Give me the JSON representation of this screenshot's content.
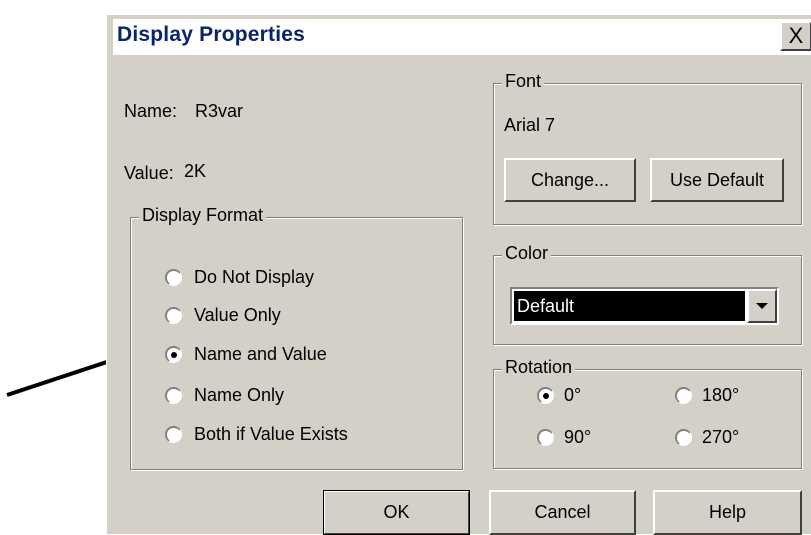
{
  "dialog": {
    "title": "Display Properties",
    "close_symbol": "X",
    "name_label": "Name:",
    "name_value": "R3var",
    "value_label": "Value:",
    "value_value": "2K"
  },
  "display_format": {
    "legend": "Display Format",
    "options": [
      {
        "label": "Do Not Display",
        "checked": false
      },
      {
        "label": "Value Only",
        "checked": false
      },
      {
        "label": "Name and Value",
        "checked": true
      },
      {
        "label": "Name Only",
        "checked": false
      },
      {
        "label": "Both if Value Exists",
        "checked": false
      }
    ]
  },
  "font": {
    "legend": "Font",
    "current": "Arial 7",
    "change_label": "Change...",
    "default_label": "Use Default"
  },
  "color": {
    "legend": "Color",
    "selected": "Default"
  },
  "rotation": {
    "legend": "Rotation",
    "options": [
      {
        "label": "0°",
        "checked": true
      },
      {
        "label": "180°",
        "checked": false
      },
      {
        "label": "90°",
        "checked": false
      },
      {
        "label": "270°",
        "checked": false
      }
    ]
  },
  "buttons": {
    "ok": "OK",
    "cancel": "Cancel",
    "help": "Help"
  },
  "annotation": {
    "arrow_color": "#000000"
  }
}
